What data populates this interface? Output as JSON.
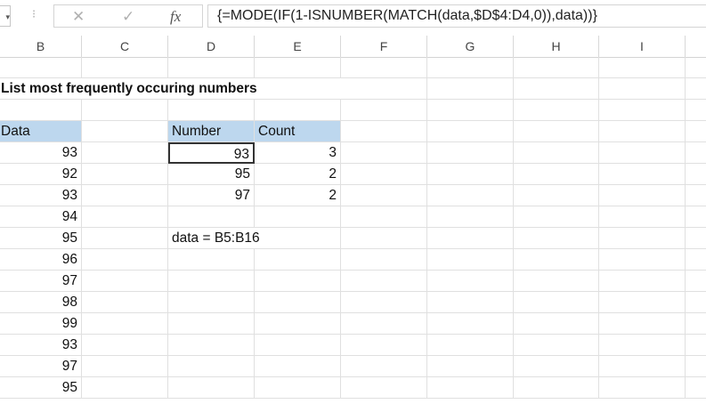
{
  "formula_bar": {
    "name_box_arrow": "▾",
    "cancel_icon": "✕",
    "enter_icon": "✓",
    "fx_label": "fx",
    "formula": "{=MODE(IF(1-ISNUMBER(MATCH(data,$D$4:D4,0)),data))}"
  },
  "columns": [
    "B",
    "C",
    "D",
    "E",
    "F",
    "G",
    "H",
    "I"
  ],
  "sheet": {
    "title": "List most frequently occuring numbers",
    "data_header": "Data",
    "data": [
      "93",
      "92",
      "93",
      "94",
      "95",
      "96",
      "97",
      "98",
      "99",
      "93",
      "97",
      "95"
    ],
    "result_headers": [
      "Number",
      "Count"
    ],
    "results": [
      {
        "number": "93",
        "count": "3"
      },
      {
        "number": "95",
        "count": "2"
      },
      {
        "number": "97",
        "count": "2"
      }
    ],
    "note": "data = B5:B16"
  },
  "colors": {
    "header_fill": "#bdd7ee"
  }
}
